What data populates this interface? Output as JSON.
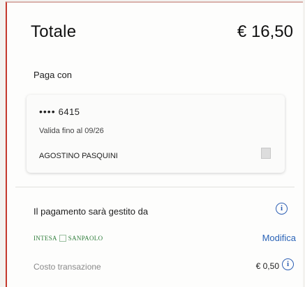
{
  "summary": {
    "total_label": "Totale",
    "total_amount": "€ 16,50",
    "pay_with_label": "Paga con"
  },
  "card": {
    "masked_dots": "••••",
    "last_digits": "6415",
    "expiry": "Valida fino al 09/26",
    "holder": "AGOSTINO PASQUINI"
  },
  "payment": {
    "managed_by_label": "Il pagamento sarà gestito da",
    "info_icon": "info-icon",
    "bank_name_left": "INTESA",
    "bank_name_right": "SANPAOLO",
    "modify_label": "Modifica",
    "fee_label": "Costo transazione",
    "fee_value": "€ 0,50"
  },
  "colors": {
    "accent_link": "#2a63b7",
    "bank_green": "#2e7d3a",
    "border_red": "#c4392d"
  }
}
